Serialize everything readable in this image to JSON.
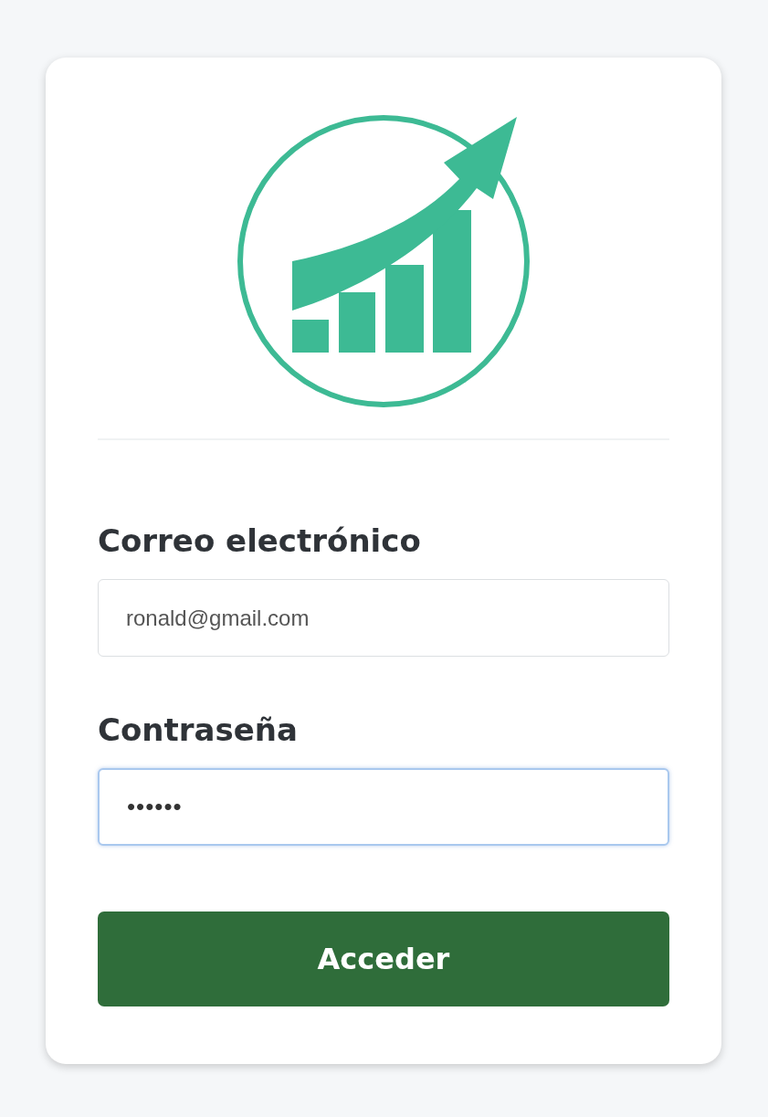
{
  "fields": [
    {
      "label": "Correo electrónico",
      "value": "ronald@gmail.com",
      "focused": false
    },
    {
      "label": "Contraseña",
      "value": "••••••",
      "focused": true
    }
  ],
  "button": "Acceder"
}
